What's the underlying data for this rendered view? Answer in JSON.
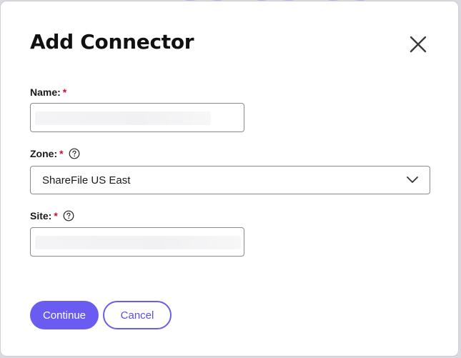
{
  "dialog": {
    "title": "Add Connector",
    "close_icon": "close-icon"
  },
  "fields": {
    "name": {
      "label": "Name:",
      "required_mark": "*",
      "value": ""
    },
    "zone": {
      "label": "Zone:",
      "required_mark": "*",
      "help_icon": "help-icon",
      "selected": "ShareFile US East",
      "chevron_icon": "chevron-down-icon"
    },
    "site": {
      "label": "Site:",
      "required_mark": "*",
      "help_icon": "help-icon",
      "value": ""
    }
  },
  "actions": {
    "continue_label": "Continue",
    "cancel_label": "Cancel"
  },
  "colors": {
    "primary": "#6a5cf1",
    "required": "#c8102e",
    "text": "#111111"
  }
}
